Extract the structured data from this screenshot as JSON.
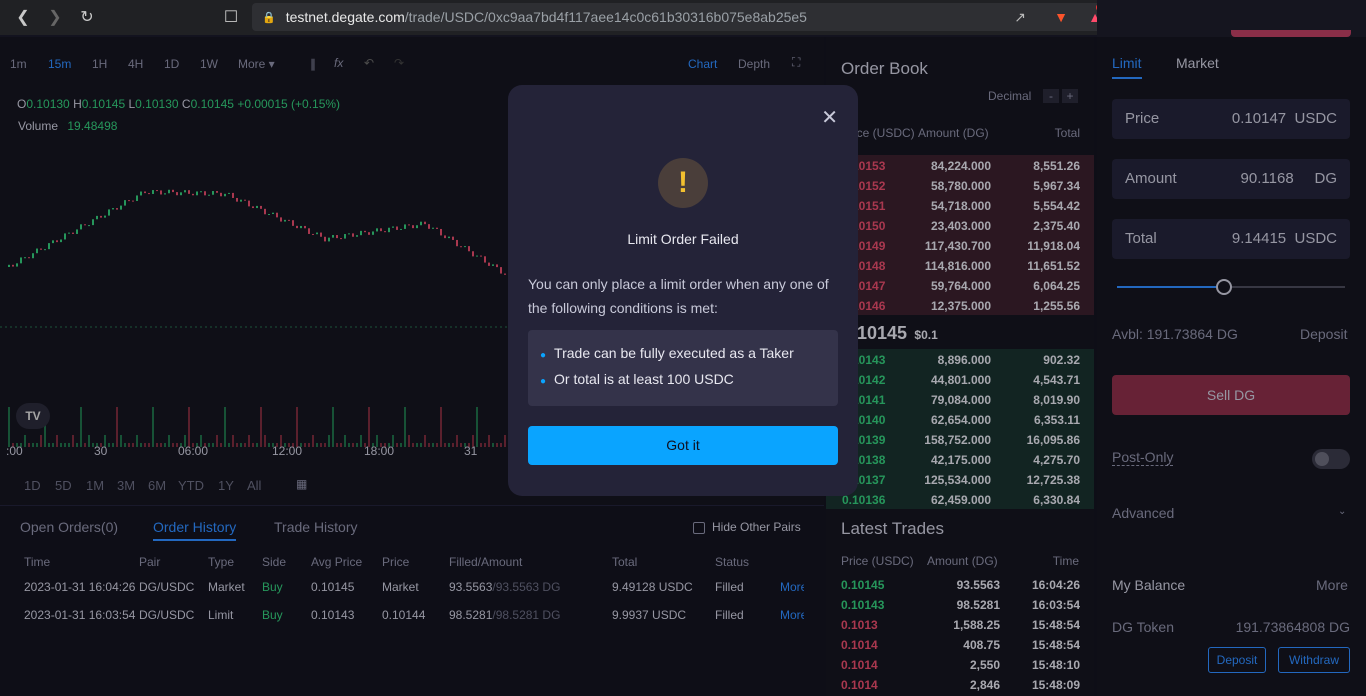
{
  "browser": {
    "url_host": "testnet.degate.com",
    "url_path": "/trade/USDC/0xc9aa7bd4f117aee14c0c61b30316b075e8ab25e5",
    "notif_count": "1"
  },
  "chart": {
    "timeframes": [
      "1m",
      "15m",
      "1H",
      "4H",
      "1D",
      "1W",
      "More"
    ],
    "active_tf": "15m",
    "view_tabs": [
      "Chart",
      "Depth"
    ],
    "ohlc": {
      "o_label": "O",
      "o": "0.10130",
      "h_label": "H",
      "h": "0.10145",
      "l_label": "L",
      "l": "0.10130",
      "c_label": "C",
      "c": "0.10145",
      "change": "+0.00015 (+0.15%)"
    },
    "volume_label": "Volume",
    "volume_value": "19.48498",
    "time_ticks": [
      ":00",
      "30",
      "06:00",
      "12:00",
      "18:00",
      "31"
    ],
    "ranges": [
      "1D",
      "5D",
      "1M",
      "3M",
      "6M",
      "YTD",
      "1Y",
      "All"
    ]
  },
  "bottom": {
    "tabs": [
      "Open Orders(0)",
      "Order History",
      "Trade History"
    ],
    "hide_other_pairs": "Hide Other Pairs",
    "columns": [
      "Time",
      "Pair",
      "Type",
      "Side",
      "Avg Price",
      "Price",
      "Filled/Amount",
      "Total",
      "Status"
    ],
    "rows": [
      {
        "time": "2023-01-31 16:04:26",
        "pair": "DG/USDC",
        "type": "Market",
        "side": "Buy",
        "avg": "0.10145",
        "price": "Market",
        "filled": "93.5563",
        "amount": "/93.5563 DG",
        "total": "9.49128 USDC",
        "status": "Filled",
        "more": "More"
      },
      {
        "time": "2023-01-31 16:03:54",
        "pair": "DG/USDC",
        "type": "Limit",
        "side": "Buy",
        "avg": "0.10143",
        "price": "0.10144",
        "filled": "98.5281",
        "amount": "/98.5281 DG",
        "total": "9.9937 USDC",
        "status": "Filled",
        "more": "More"
      }
    ]
  },
  "orderbook": {
    "title": "Order Book",
    "decimal": "Decimal",
    "head_price": "Price (USDC)",
    "head_amount": "Amount (DG)",
    "head_total": "Total",
    "asks": [
      {
        "p": "0.10153",
        "a": "84,224.000",
        "t": "8,551.26"
      },
      {
        "p": "0.10152",
        "a": "58,780.000",
        "t": "5,967.34"
      },
      {
        "p": "0.10151",
        "a": "54,718.000",
        "t": "5,554.42"
      },
      {
        "p": "0.10150",
        "a": "23,403.000",
        "t": "2,375.40"
      },
      {
        "p": "0.10149",
        "a": "117,430.700",
        "t": "11,918.04"
      },
      {
        "p": "0.10148",
        "a": "114,816.000",
        "t": "11,651.52"
      },
      {
        "p": "0.10147",
        "a": "59,764.000",
        "t": "6,064.25"
      },
      {
        "p": "0.10146",
        "a": "12,375.000",
        "t": "1,255.56"
      }
    ],
    "mid": "0.10145",
    "mid_usd": "$0.1",
    "bids": [
      {
        "p": "0.10143",
        "a": "8,896.000",
        "t": "902.32"
      },
      {
        "p": "0.10142",
        "a": "44,801.000",
        "t": "4,543.71"
      },
      {
        "p": "0.10141",
        "a": "79,084.000",
        "t": "8,019.90"
      },
      {
        "p": "0.10140",
        "a": "62,654.000",
        "t": "6,353.11"
      },
      {
        "p": "0.10139",
        "a": "158,752.000",
        "t": "16,095.86"
      },
      {
        "p": "0.10138",
        "a": "42,175.000",
        "t": "4,275.70"
      },
      {
        "p": "0.10137",
        "a": "125,534.000",
        "t": "12,725.38"
      },
      {
        "p": "0.10136",
        "a": "62,459.000",
        "t": "6,330.84"
      }
    ]
  },
  "trades": {
    "title": "Latest Trades",
    "head_price": "Price (USDC)",
    "head_amount": "Amount (DG)",
    "head_time": "Time",
    "rows": [
      {
        "p": "0.10145",
        "a": "93.5563",
        "t": "16:04:26",
        "side": "buy"
      },
      {
        "p": "0.10143",
        "a": "98.5281",
        "t": "16:03:54",
        "side": "buy"
      },
      {
        "p": "0.1013",
        "a": "1,588.25",
        "t": "15:48:54",
        "side": "sell"
      },
      {
        "p": "0.1014",
        "a": "408.75",
        "t": "15:48:54",
        "side": "sell"
      },
      {
        "p": "0.1014",
        "a": "2,550",
        "t": "15:48:10",
        "side": "sell"
      },
      {
        "p": "0.1014",
        "a": "2,846",
        "t": "15:48:09",
        "side": "sell"
      }
    ]
  },
  "form": {
    "tabs": [
      "Limit",
      "Market"
    ],
    "price_label": "Price",
    "price_value": "0.10147",
    "price_unit": "USDC",
    "amount_label": "Amount",
    "amount_value": "90.1168",
    "amount_unit": "DG",
    "total_label": "Total",
    "total_value": "9.14415",
    "total_unit": "USDC",
    "slider_fraction": 0.47,
    "avbl": "Avbl: 191.73864 DG",
    "deposit": "Deposit",
    "sell_button": "Sell DG",
    "post_only": "Post-Only",
    "advanced": "Advanced",
    "balance_title": "My Balance",
    "balance_more": "More",
    "token_name": "DG Token",
    "token_amount": "191.73864808 DG",
    "deposit_btn": "Deposit",
    "withdraw_btn": "Withdraw"
  },
  "modal": {
    "title": "Limit Order Failed",
    "body": "You can only place a limit order when any one of the following conditions is met:",
    "conditions": [
      "Trade can be fully executed as a Taker",
      "Or total is at least 100 USDC"
    ],
    "button": "Got it",
    "colors": {
      "accent": "#0aa4ff",
      "warn": "#f2c02f"
    }
  }
}
